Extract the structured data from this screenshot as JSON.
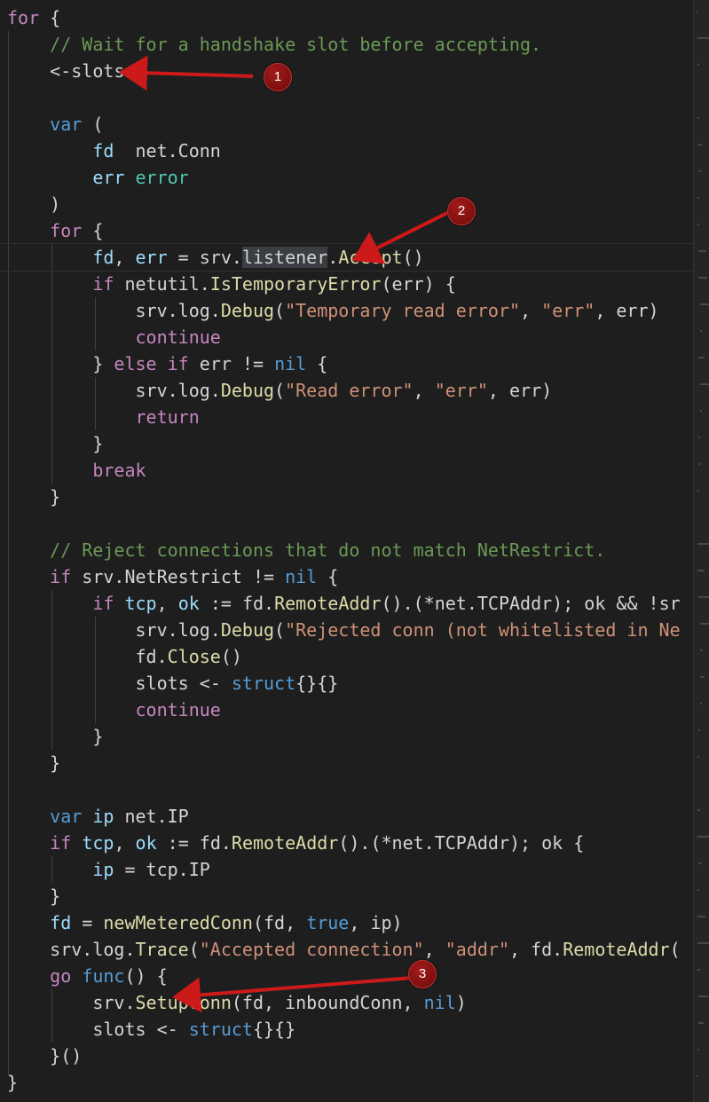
{
  "code_lines": [
    [
      {
        "t": "for",
        "c": "ctl"
      },
      {
        "t": " {"
      }
    ],
    [
      {
        "t": "    "
      },
      {
        "t": "// Wait for a handshake slot before accepting.",
        "c": "cm"
      }
    ],
    [
      {
        "t": "    <-slots"
      }
    ],
    [
      {
        "t": ""
      }
    ],
    [
      {
        "t": "    "
      },
      {
        "t": "var",
        "c": "kw"
      },
      {
        "t": " ("
      }
    ],
    [
      {
        "t": "        "
      },
      {
        "t": "fd",
        "c": "var"
      },
      {
        "t": "  net.Conn"
      }
    ],
    [
      {
        "t": "        "
      },
      {
        "t": "err",
        "c": "var"
      },
      {
        "t": " "
      },
      {
        "t": "error",
        "c": "typ"
      }
    ],
    [
      {
        "t": "    )"
      }
    ],
    [
      {
        "t": "    "
      },
      {
        "t": "for",
        "c": "ctl"
      },
      {
        "t": " {"
      }
    ],
    [
      {
        "t": "        "
      },
      {
        "t": "fd",
        "c": "var"
      },
      {
        "t": ", "
      },
      {
        "t": "err",
        "c": "var"
      },
      {
        "t": " = srv."
      },
      {
        "t": "listener",
        "c": "sel"
      },
      {
        "t": "."
      },
      {
        "t": "Accept",
        "c": "fn"
      },
      {
        "t": "()"
      }
    ],
    [
      {
        "t": "        "
      },
      {
        "t": "if",
        "c": "ctl"
      },
      {
        "t": " netutil."
      },
      {
        "t": "IsTemporaryError",
        "c": "fn"
      },
      {
        "t": "(err) {"
      }
    ],
    [
      {
        "t": "            srv.log."
      },
      {
        "t": "Debug",
        "c": "fn"
      },
      {
        "t": "("
      },
      {
        "t": "\"Temporary read error\"",
        "c": "str"
      },
      {
        "t": ", "
      },
      {
        "t": "\"err\"",
        "c": "str"
      },
      {
        "t": ", err)"
      }
    ],
    [
      {
        "t": "            "
      },
      {
        "t": "continue",
        "c": "ctl"
      }
    ],
    [
      {
        "t": "        } "
      },
      {
        "t": "else",
        "c": "ctl"
      },
      {
        "t": " "
      },
      {
        "t": "if",
        "c": "ctl"
      },
      {
        "t": " err != "
      },
      {
        "t": "nil",
        "c": "kw"
      },
      {
        "t": " {"
      }
    ],
    [
      {
        "t": "            srv.log."
      },
      {
        "t": "Debug",
        "c": "fn"
      },
      {
        "t": "("
      },
      {
        "t": "\"Read error\"",
        "c": "str"
      },
      {
        "t": ", "
      },
      {
        "t": "\"err\"",
        "c": "str"
      },
      {
        "t": ", err)"
      }
    ],
    [
      {
        "t": "            "
      },
      {
        "t": "return",
        "c": "ctl"
      }
    ],
    [
      {
        "t": "        }"
      }
    ],
    [
      {
        "t": "        "
      },
      {
        "t": "break",
        "c": "ctl"
      }
    ],
    [
      {
        "t": "    }"
      }
    ],
    [
      {
        "t": ""
      }
    ],
    [
      {
        "t": "    "
      },
      {
        "t": "// Reject connections that do not match NetRestrict.",
        "c": "cm"
      }
    ],
    [
      {
        "t": "    "
      },
      {
        "t": "if",
        "c": "ctl"
      },
      {
        "t": " srv.NetRestrict != "
      },
      {
        "t": "nil",
        "c": "kw"
      },
      {
        "t": " {"
      }
    ],
    [
      {
        "t": "        "
      },
      {
        "t": "if",
        "c": "ctl"
      },
      {
        "t": " "
      },
      {
        "t": "tcp",
        "c": "var"
      },
      {
        "t": ", "
      },
      {
        "t": "ok",
        "c": "var"
      },
      {
        "t": " := fd."
      },
      {
        "t": "RemoteAddr",
        "c": "fn"
      },
      {
        "t": "().(*net.TCPAddr); ok && !sr"
      }
    ],
    [
      {
        "t": "            srv.log."
      },
      {
        "t": "Debug",
        "c": "fn"
      },
      {
        "t": "("
      },
      {
        "t": "\"Rejected conn (not whitelisted in Ne",
        "c": "str"
      }
    ],
    [
      {
        "t": "            fd."
      },
      {
        "t": "Close",
        "c": "fn"
      },
      {
        "t": "()"
      }
    ],
    [
      {
        "t": "            slots <- "
      },
      {
        "t": "struct",
        "c": "kw"
      },
      {
        "t": "{}{}"
      }
    ],
    [
      {
        "t": "            "
      },
      {
        "t": "continue",
        "c": "ctl"
      }
    ],
    [
      {
        "t": "        }"
      }
    ],
    [
      {
        "t": "    }"
      }
    ],
    [
      {
        "t": ""
      }
    ],
    [
      {
        "t": "    "
      },
      {
        "t": "var",
        "c": "kw"
      },
      {
        "t": " "
      },
      {
        "t": "ip",
        "c": "var"
      },
      {
        "t": " net.IP"
      }
    ],
    [
      {
        "t": "    "
      },
      {
        "t": "if",
        "c": "ctl"
      },
      {
        "t": " "
      },
      {
        "t": "tcp",
        "c": "var"
      },
      {
        "t": ", "
      },
      {
        "t": "ok",
        "c": "var"
      },
      {
        "t": " := fd."
      },
      {
        "t": "RemoteAddr",
        "c": "fn"
      },
      {
        "t": "().(*net.TCPAddr); ok {"
      }
    ],
    [
      {
        "t": "        "
      },
      {
        "t": "ip",
        "c": "var"
      },
      {
        "t": " = tcp.IP"
      }
    ],
    [
      {
        "t": "    }"
      }
    ],
    [
      {
        "t": "    "
      },
      {
        "t": "fd",
        "c": "var"
      },
      {
        "t": " = "
      },
      {
        "t": "newMeteredConn",
        "c": "fn"
      },
      {
        "t": "(fd, "
      },
      {
        "t": "true",
        "c": "kw"
      },
      {
        "t": ", ip)"
      }
    ],
    [
      {
        "t": "    srv.log."
      },
      {
        "t": "Trace",
        "c": "fn"
      },
      {
        "t": "("
      },
      {
        "t": "\"Accepted connection\"",
        "c": "str"
      },
      {
        "t": ", "
      },
      {
        "t": "\"addr\"",
        "c": "str"
      },
      {
        "t": ", fd."
      },
      {
        "t": "RemoteAddr",
        "c": "fn"
      },
      {
        "t": "("
      }
    ],
    [
      {
        "t": "    "
      },
      {
        "t": "go",
        "c": "ctl"
      },
      {
        "t": " "
      },
      {
        "t": "func",
        "c": "kw"
      },
      {
        "t": "() {"
      }
    ],
    [
      {
        "t": "        srv."
      },
      {
        "t": "SetupConn",
        "c": "fn"
      },
      {
        "t": "(fd, inboundConn, "
      },
      {
        "t": "nil",
        "c": "kw"
      },
      {
        "t": ")"
      }
    ],
    [
      {
        "t": "        slots <- "
      },
      {
        "t": "struct",
        "c": "kw"
      },
      {
        "t": "{}{}"
      }
    ],
    [
      {
        "t": "    }()"
      }
    ],
    [
      {
        "t": "}"
      }
    ]
  ],
  "annotations": [
    {
      "number": "1",
      "target_line": 3
    },
    {
      "number": "2",
      "target_line": 10
    },
    {
      "number": "3",
      "target_line": 38
    }
  ],
  "colors": {
    "background": "#1e1e1e",
    "keyword": "#569cd6",
    "control": "#c586c0",
    "function": "#dcdcaa",
    "string": "#ce9178",
    "comment": "#6a9955",
    "type": "#4ec9b0",
    "arrow": "#cc1a1a"
  }
}
